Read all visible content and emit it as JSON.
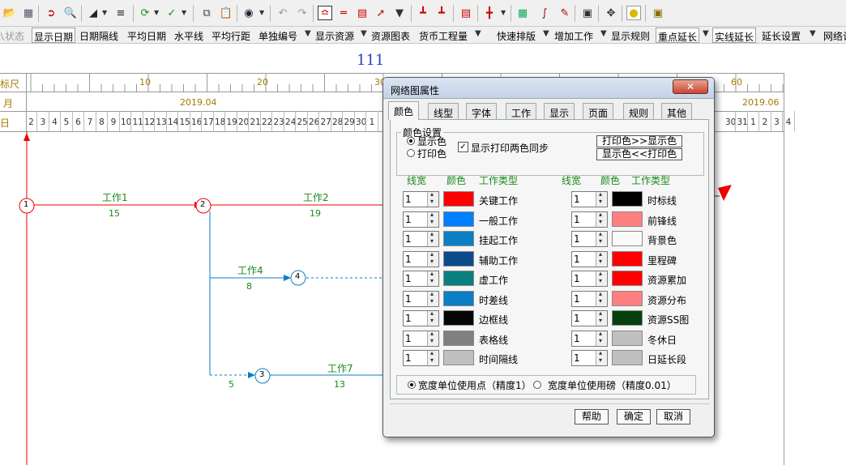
{
  "toolbar_top": {
    "icons": [
      "open-folder-icon",
      "save-icon",
      "exit-icon",
      "print-preview-icon",
      "line-style-icon",
      "outline-icon",
      "refresh-icon",
      "check-icon",
      "copy-icon",
      "paste-icon",
      "find-icon",
      "undo-icon",
      "redo-icon",
      "network-view-icon",
      "gantt-view-icon",
      "timescale-view-icon",
      "curve-icon",
      "resource-icon",
      "split-icon",
      "merge-icon",
      "chart-icon",
      "layout-icon",
      "library-icon",
      "calc-icon",
      "edit-icon",
      "monitor-icon",
      "pan-icon",
      "lightbulb-icon",
      "lock-icon"
    ]
  },
  "toolbar_second": {
    "items": [
      "八状态",
      "显示日期",
      "日期隔线",
      "平均日期",
      "水平线",
      "平均行距",
      "单独编号",
      "显示资源",
      "资源图表",
      "货币工程量",
      "快速排版",
      "增加工作",
      "显示规则",
      "重点延长",
      "实线延长",
      "延长设置",
      "网络计"
    ]
  },
  "chart": {
    "title": "111",
    "ruler_label": "标尺",
    "month_row_label": "月",
    "day_row_label": "日",
    "ruler_ticks": [
      "10",
      "20",
      "30",
      "60"
    ],
    "months": [
      "2019.04",
      "2019.06"
    ],
    "days_april": [
      "2",
      "3",
      "4",
      "5",
      "6",
      "7",
      "8",
      "9",
      "10",
      "11",
      "12",
      "13",
      "14",
      "15",
      "16",
      "17",
      "18",
      "19",
      "20",
      "21",
      "22",
      "23",
      "24",
      "25",
      "26",
      "27",
      "28",
      "29",
      "30",
      "1"
    ],
    "days_june": [
      "30",
      "31",
      "1",
      "2",
      "3",
      "4"
    ],
    "nodes": [
      "1",
      "2",
      "3",
      "4"
    ],
    "works": [
      {
        "name": "工作1",
        "duration": "15"
      },
      {
        "name": "工作2",
        "duration": "19"
      },
      {
        "name": "工作4",
        "duration": "8"
      },
      {
        "name": "工作7",
        "duration": "13"
      },
      {
        "name": "",
        "duration": "5"
      }
    ]
  },
  "dialog": {
    "title": "网络图属性",
    "close": "✕",
    "tabs": [
      "颜色",
      "线型",
      "字体",
      "工作",
      "显示",
      "页面",
      "规则",
      "其他"
    ],
    "group_title": "颜色设置",
    "radio_display": "显示色",
    "radio_print": "打印色",
    "sync_checkbox": "显示打印两色同步",
    "btn_print_to_display": "打印色>>显示色",
    "btn_display_to_print": "显示色<<打印色",
    "col_width": "线宽",
    "col_color": "颜色",
    "col_type": "工作类型",
    "left_rows": [
      {
        "width": "1",
        "color": "#ff0000",
        "label": "关键工作"
      },
      {
        "width": "1",
        "color": "#0080ff",
        "label": "一般工作"
      },
      {
        "width": "1",
        "color": "#0a7fc4",
        "label": "挂起工作"
      },
      {
        "width": "1",
        "color": "#0c4a8c",
        "label": "辅助工作"
      },
      {
        "width": "1",
        "color": "#0a8080",
        "label": "虚工作"
      },
      {
        "width": "1",
        "color": "#0a7fc4",
        "label": "时差线"
      },
      {
        "width": "1",
        "color": "#050505",
        "label": "边框线"
      },
      {
        "width": "1",
        "color": "#808080",
        "label": "表格线"
      },
      {
        "width": "1",
        "color": "#c0c0c0",
        "label": "时间隔线"
      }
    ],
    "right_rows": [
      {
        "width": "1",
        "color": "#000000",
        "label": "时标线"
      },
      {
        "width": "1",
        "color": "#ff8080",
        "label": "前锋线"
      },
      {
        "width": "1",
        "color": "#fafafa",
        "label": "背景色"
      },
      {
        "width": "1",
        "color": "#ff0000",
        "label": "里程碑"
      },
      {
        "width": "1",
        "color": "#ff0000",
        "label": "资源累加"
      },
      {
        "width": "1",
        "color": "#ff8080",
        "label": "资源分布"
      },
      {
        "width": "1",
        "color": "#06400c",
        "label": "资源SS图"
      },
      {
        "width": "1",
        "color": "#c0c0c0",
        "label": "冬休日"
      },
      {
        "width": "1",
        "color": "#c0c0c0",
        "label": "日延长段"
      }
    ],
    "unit_point": "宽度单位使用点（精度1）",
    "unit_pound": "宽度单位使用磅（精度0.01）",
    "btn_help": "帮助",
    "btn_ok": "确定",
    "btn_cancel": "取消"
  }
}
